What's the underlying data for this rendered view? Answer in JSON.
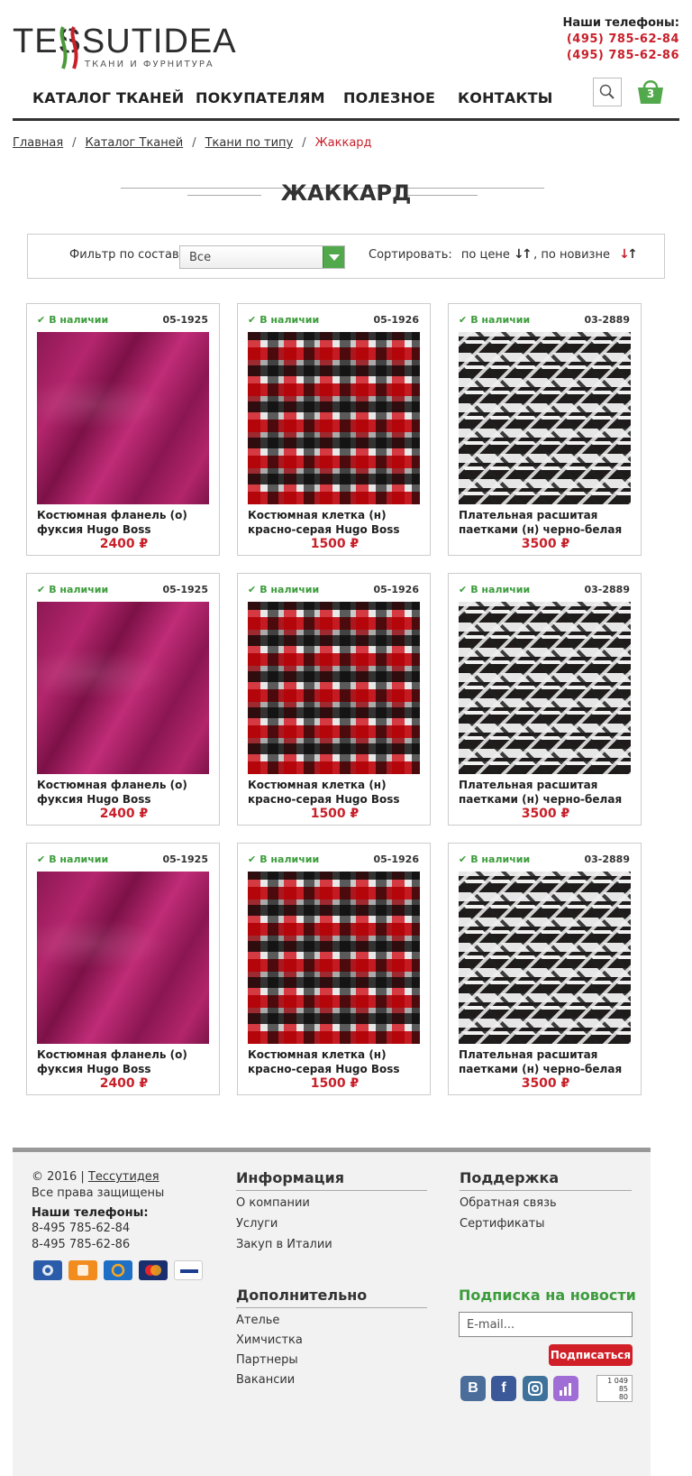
{
  "header": {
    "logo_text": "TESSUTIDEA",
    "logo_sub": "ТКАНИ И ФУРНИТУРА",
    "phones_title": "Наши телефоны:",
    "phone1": "(495) 785-62-84",
    "phone2": "(495) 785-62-86",
    "cart_count": "3"
  },
  "nav": {
    "items": [
      {
        "label": "КАТАЛОГ ТКАНЕЙ"
      },
      {
        "label": "ПОКУПАТЕЛЯМ"
      },
      {
        "label": "ПОЛЕЗНОЕ"
      },
      {
        "label": "КОНТАКТЫ"
      }
    ]
  },
  "breadcrumb": {
    "items": [
      "Главная",
      "Каталог Тканей",
      "Ткани по типу"
    ],
    "separator": "/",
    "current": "Жаккард"
  },
  "page": {
    "title": "ЖАККАРД"
  },
  "filter": {
    "label": "Фильтр по составу:",
    "selected": "Все",
    "sort_label": "Сортировать:",
    "sort_price": "по цене",
    "sort_new": ", по новизне"
  },
  "products": [
    {
      "stock": "В наличии",
      "sku": "05-1925",
      "name": "Костюмная фланель (о) фуксия Hugo Boss",
      "price": "2400 ₽",
      "fabric": "fuchsia"
    },
    {
      "stock": "В наличии",
      "sku": "05-1926",
      "name": "Костюмная клетка (н) красно-серая Hugo Boss",
      "price": "1500 ₽",
      "fabric": "plaid"
    },
    {
      "stock": "В наличии",
      "sku": "03-2889",
      "name": "Плательная расшитая паетками (н) черно-белая",
      "price": "3500 ₽",
      "fabric": "zigzag"
    },
    {
      "stock": "В наличии",
      "sku": "05-1925",
      "name": "Костюмная фланель (о) фуксия Hugo Boss",
      "price": "2400 ₽",
      "fabric": "fuchsia"
    },
    {
      "stock": "В наличии",
      "sku": "05-1926",
      "name": "Костюмная клетка (н) красно-серая Hugo Boss",
      "price": "1500 ₽",
      "fabric": "plaid"
    },
    {
      "stock": "В наличии",
      "sku": "03-2889",
      "name": "Плательная расшитая паетками (н) черно-белая",
      "price": "3500 ₽",
      "fabric": "zigzag"
    },
    {
      "stock": "В наличии",
      "sku": "05-1925",
      "name": "Костюмная фланель (о) фуксия Hugo Boss",
      "price": "2400 ₽",
      "fabric": "fuchsia"
    },
    {
      "stock": "В наличии",
      "sku": "05-1926",
      "name": "Костюмная клетка (н) красно-серая Hugo Boss",
      "price": "1500 ₽",
      "fabric": "plaid"
    },
    {
      "stock": "В наличии",
      "sku": "03-2889",
      "name": "Плательная расшитая паетками (н) черно-белая",
      "price": "3500 ₽",
      "fabric": "zigzag"
    }
  ],
  "footer": {
    "copyright": "© 2016 |",
    "copyright_link": "Тессутидея",
    "rights": "Все права защищены",
    "phones_title": "Наши телефоны:",
    "phone1": "8-495 785-62-84",
    "phone2": "8-495 785-62-86",
    "payments": [
      "webmoney",
      "yandex-money",
      "qiwi",
      "mastercard",
      "visa"
    ],
    "info_title": "Информация",
    "info_links": [
      "О компании",
      "Услуги",
      "Закуп в Италии"
    ],
    "support_title": "Поддержка",
    "support_links": [
      "Обратная связь",
      "Сертификаты"
    ],
    "extra_title": "Дополнительно",
    "extra_links": [
      "Ателье",
      "Химчистка",
      "Партнеры",
      "Вакансии"
    ],
    "subscribe_title": "Подписка на новости",
    "email_placeholder": "E-mail...",
    "subscribe_button": "Подписаться",
    "social": [
      "В",
      "f"
    ],
    "counter": [
      "1 049",
      "85",
      "80"
    ]
  },
  "colors": {
    "accent_red": "#c8202a",
    "stock_green": "#3c9c3c",
    "select_green": "#52a94c"
  }
}
